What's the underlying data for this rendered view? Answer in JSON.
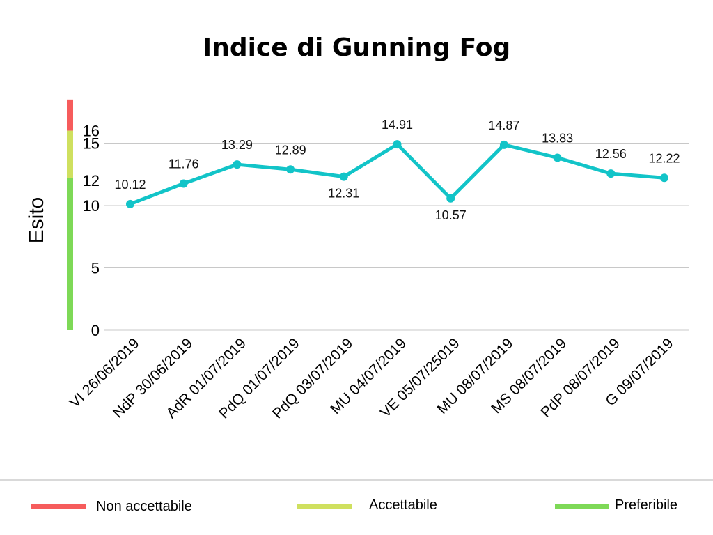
{
  "chart_data": {
    "type": "line",
    "title": "Indice di Gunning Fog",
    "ylabel": "Esito",
    "xlabel": "",
    "ylim": [
      0,
      16
    ],
    "yticks": [
      0,
      5,
      10,
      12,
      15,
      16
    ],
    "gridlines": [
      0,
      5,
      10,
      15
    ],
    "grid": true,
    "categories": [
      "VI 26/06/2019",
      "NdP 30/06/2019",
      "AdR 01/07/2019",
      "PdQ 01/07/2019",
      "PdQ 03/07/2019",
      "MU 04/07/2019",
      "VE 05/07/25019",
      "MU 08/07/2019",
      "MS 08/07/2019",
      "PdP 08/07/2019",
      "G 09/07/2019"
    ],
    "series": [
      {
        "values": [
          10.12,
          11.76,
          13.29,
          12.89,
          12.31,
          14.91,
          10.57,
          14.87,
          13.83,
          12.56,
          12.22
        ],
        "color": "#12c4c8"
      }
    ],
    "data_labels": [
      "10.12",
      "11.76",
      "13.29",
      "12.89",
      "12.31",
      "14.91",
      "10.57",
      "14.87",
      "13.83",
      "12.56",
      "12.22"
    ],
    "label_below": [
      false,
      false,
      false,
      false,
      true,
      false,
      true,
      false,
      false,
      false,
      false
    ],
    "threshold_bands": [
      {
        "name": "Non accettabile",
        "from": 16,
        "to": 18.5,
        "color": "#f65c5c"
      },
      {
        "name": "Accettabile",
        "from": 12.2,
        "to": 16,
        "color": "#cfe05f"
      },
      {
        "name": "Preferibile",
        "from": 0,
        "to": 12.2,
        "color": "#7ed957"
      }
    ],
    "legend": {
      "position": "bottom",
      "items": [
        {
          "label": "Non accettabile",
          "color": "#f65c5c"
        },
        {
          "label": "Accettabile",
          "color": "#cfe05f"
        },
        {
          "label": "Preferibile",
          "color": "#7ed957"
        }
      ]
    }
  }
}
